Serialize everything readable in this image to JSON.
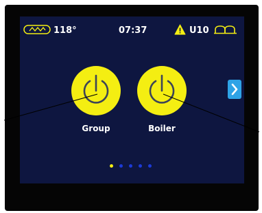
{
  "status_bar": {
    "temperature": "118°",
    "time": "07:37",
    "unit_code": "U10",
    "temperature_icon": "zigzag-heater-icon",
    "warning_icon": "warning-triangle-icon",
    "cup_icon": "cups-icon"
  },
  "controls": [
    {
      "label": "Group",
      "icon": "power-icon"
    },
    {
      "label": "Boiler",
      "icon": "power-icon"
    }
  ],
  "navigation": {
    "next_icon": "chevron-right-icon",
    "page_count": 5,
    "current_page": 1
  },
  "colors": {
    "screen_background": "#0e1640",
    "button_yellow": "#f4ee12",
    "accent_blue": "#2ea3e6",
    "dot_inactive": "#1c3ad6",
    "warning_yellow": "#f4ee12"
  }
}
